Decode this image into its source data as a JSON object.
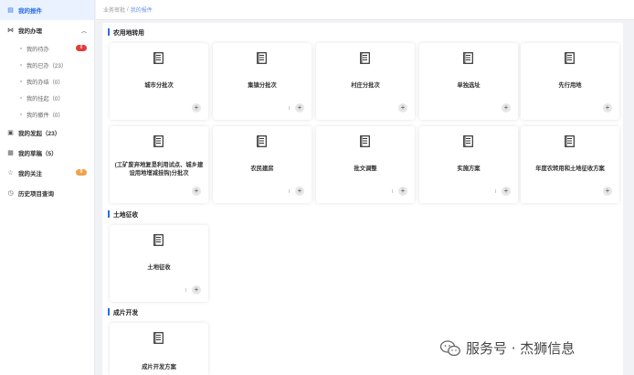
{
  "sidebar": {
    "items": [
      {
        "label": "我的报件",
        "icon": "document-icon",
        "active": true
      },
      {
        "label": "我的办理",
        "icon": "flow-icon",
        "expanded": true,
        "children": [
          {
            "label": "我的待办",
            "badge": "6"
          },
          {
            "label": "我的已办（23）"
          },
          {
            "label": "我的办结（0）"
          },
          {
            "label": "我的挂起（0）"
          },
          {
            "label": "我的撤件（0）"
          }
        ]
      },
      {
        "label": "我的发起（23）",
        "icon": "send-icon"
      },
      {
        "label": "我的草稿（5）",
        "icon": "draft-icon"
      },
      {
        "label": "我的关注",
        "icon": "star-icon",
        "badge": "0"
      },
      {
        "label": "历史项目查询",
        "icon": "history-icon"
      }
    ]
  },
  "breadcrumb": {
    "root": "业务审批",
    "separator": "/",
    "current": "我的报件"
  },
  "sections": [
    {
      "title": "农用地转用",
      "cards": [
        "城市分批次",
        "集镇分批次",
        "村庄分批次",
        "单独选址",
        "先行用地",
        "(工矿废弃地复垦利用试点、城乡建设用地增减挂钩)分批次",
        "农民建房",
        "批文调整",
        "实施方案",
        "年度农转用和土地征收方案"
      ]
    },
    {
      "title": "土地征收",
      "cards": [
        "土地征收"
      ]
    },
    {
      "title": "成片开发",
      "cards": [
        "成片开发方案"
      ]
    }
  ],
  "card_add_label": "+",
  "watermark": {
    "text": "服务号 · 杰狮信息"
  },
  "colors": {
    "accent": "#2b6de5",
    "badge_red": "#e23c3c",
    "badge_orange": "#f0a24a"
  }
}
